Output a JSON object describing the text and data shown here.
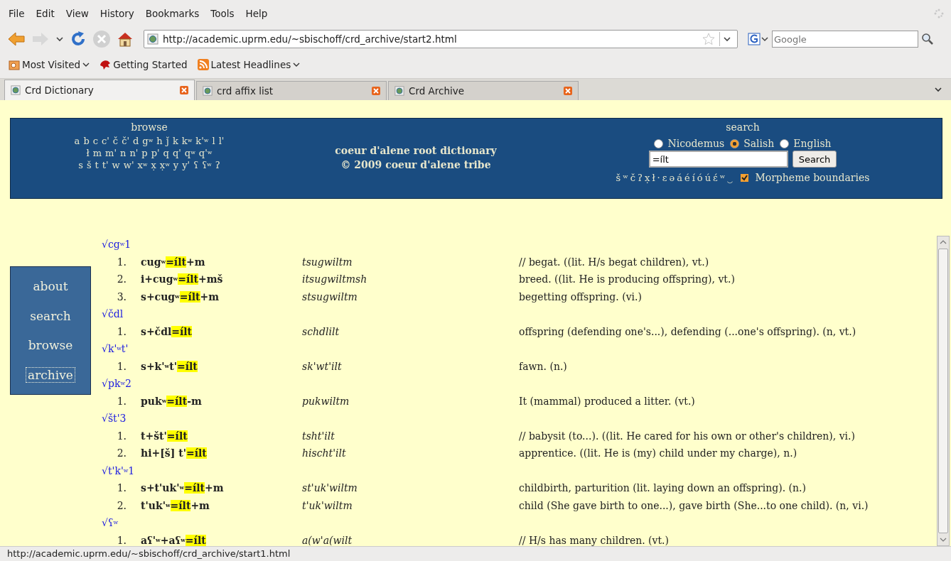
{
  "menu": [
    "File",
    "Edit",
    "View",
    "History",
    "Bookmarks",
    "Tools",
    "Help"
  ],
  "nav": {
    "url": "http://academic.uprm.edu/~sbischoff/crd_archive/start2.html",
    "search_placeholder": "Google"
  },
  "bookmarks": [
    "Most Visited",
    "Getting Started",
    "Latest Headlines"
  ],
  "tabs": [
    {
      "label": "Crd Dictionary",
      "selected": true
    },
    {
      "label": "crd affix list",
      "selected": false
    },
    {
      "label": "Crd Archive",
      "selected": false
    }
  ],
  "header": {
    "browse_title": "browse",
    "letters": [
      [
        "a",
        "b",
        "c",
        "c'",
        "č",
        "č'",
        "d",
        "g$^{w}$",
        "h",
        "ǰ",
        "k",
        "k$^{w}$",
        "k'$^{w}$",
        "l",
        "l'"
      ],
      [
        "ł",
        "m",
        "m'",
        "n",
        "n'",
        "p",
        "p'",
        "q",
        "q'",
        "q$^{w}$",
        "q'$^{w}$"
      ],
      [
        "s",
        "š",
        "t",
        "t'",
        "w",
        "w'",
        "x$^{w}$",
        "x̣",
        "x̣$^{w}$",
        "y",
        "y'",
        "ʕ",
        "ʕ$^{w}$",
        "ʔ"
      ]
    ],
    "title": "coeur d'alene root dictionary",
    "copyright": "© 2009 coeur d'alene tribe",
    "search_title": "search",
    "options": [
      {
        "label": "Nicodemus",
        "selected": false
      },
      {
        "label": "Salish",
        "selected": true
      },
      {
        "label": "English",
        "selected": false
      }
    ],
    "query": "=ílt",
    "search_button": "Search",
    "special_chars": [
      "š",
      "ʷ",
      "č",
      "ʔ",
      "x̣",
      "ł",
      "·",
      "ɛ",
      "ə",
      "á",
      "é",
      "í",
      "ó",
      "ú",
      "ɛ́",
      "ʷ",
      "‿"
    ],
    "morpheme": {
      "label": "Morpheme boundaries",
      "checked": true
    }
  },
  "sidebar": [
    {
      "label": "about",
      "focused": false
    },
    {
      "label": "search",
      "focused": false
    },
    {
      "label": "browse",
      "focused": false
    },
    {
      "label": "archive",
      "focused": true
    }
  ],
  "roots": [
    {
      "root": "√cg$^{w}$1",
      "entries": [
        {
          "number": "1.",
          "pre": "cug$^{w}$",
          "match": "=ílt",
          "post": "+m",
          "nicodemus": "tsugwiltm",
          "definition": "// begat. ((lit. H/s begat children), vt.)"
        },
        {
          "number": "2.",
          "pre": "i+cug$^{w}$",
          "match": "=ílt",
          "post": "+mš",
          "nicodemus": "itsugwiltmsh",
          "definition": "breed. ((lit. He is producing offspring), vt.)"
        },
        {
          "number": "3.",
          "pre": "s+cug$^{w}$",
          "match": "=ílt",
          "post": "+m",
          "nicodemus": "stsugwiltm",
          "definition": "begetting offspring. (vi.)"
        }
      ]
    },
    {
      "root": "√čdl",
      "entries": [
        {
          "number": "1.",
          "pre": "s+čdl",
          "match": "=ílt",
          "nicodemus": "schdlilt",
          "definition": "offspring (defending one's...), defending (...one's offspring). (n, vt.)"
        }
      ]
    },
    {
      "root": "√k'$^{w}$t'",
      "entries": [
        {
          "number": "1.",
          "pre": "s+k'$^{w}$t'",
          "match": "=ílt",
          "nicodemus": "sk'wt'ilt",
          "definition": "fawn. (n.)"
        }
      ]
    },
    {
      "root": "√pk$^{w}$2",
      "entries": [
        {
          "number": "1.",
          "pre": "puk$^{w}$",
          "match": "=ílt",
          "post": "-m",
          "nicodemus": "pukwiltm",
          "definition": "It (mammal) produced a litter. (vt.)"
        }
      ]
    },
    {
      "root": "√št'3",
      "entries": [
        {
          "number": "1.",
          "pre": "t+št'",
          "match": "=ílt",
          "nicodemus": "tsht'ilt",
          "definition": "// babysit (to...). ((lit. He cared for his own or other's children), vi.)"
        },
        {
          "number": "2.",
          "pre": "hi+[š] t'",
          "match": "=ílt",
          "nicodemus": "hischt'ilt",
          "definition": "apprentice. ((lit. He is (my) child under my charge), n.)"
        }
      ]
    },
    {
      "root": "√t'k'$^{w}$1",
      "entries": [
        {
          "number": "1.",
          "pre": "s+t'uk'$^{w}$",
          "match": "=ílt",
          "post": "+m",
          "nicodemus": "st'uk'wiltm",
          "definition": "childbirth, parturition (lit. laying down an offspring). (n.)"
        },
        {
          "number": "2.",
          "pre": "t'uk'$^{w}$",
          "match": "=ílt",
          "post": "+m",
          "nicodemus": "t'uk'wiltm",
          "definition": "child (She gave birth to one...), gave birth (She...to one child). (n, vi.)"
        }
      ]
    },
    {
      "root": "√ʕ$^{w}$",
      "entries": [
        {
          "number": "1.",
          "pre": "aʕ'$^{w}$+aʕ$^{w}$",
          "match": "=ílt",
          "nicodemus": "a(w'a(wilt",
          "definition": "// H/s has many children. (vt.)"
        }
      ]
    }
  ],
  "status_bar": "http://academic.uprm.edu/~sbischoff/crd_archive/start1.html"
}
